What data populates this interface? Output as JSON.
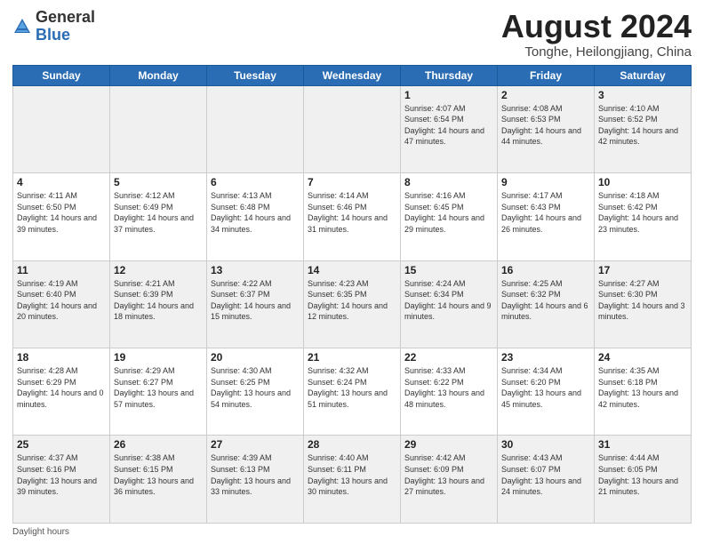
{
  "header": {
    "logo_general": "General",
    "logo_blue": "Blue",
    "month_title": "August 2024",
    "location": "Tonghe, Heilongjiang, China"
  },
  "days_of_week": [
    "Sunday",
    "Monday",
    "Tuesday",
    "Wednesday",
    "Thursday",
    "Friday",
    "Saturday"
  ],
  "weeks": [
    [
      {
        "day": "",
        "info": ""
      },
      {
        "day": "",
        "info": ""
      },
      {
        "day": "",
        "info": ""
      },
      {
        "day": "",
        "info": ""
      },
      {
        "day": "1",
        "info": "Sunrise: 4:07 AM\nSunset: 6:54 PM\nDaylight: 14 hours and 47 minutes."
      },
      {
        "day": "2",
        "info": "Sunrise: 4:08 AM\nSunset: 6:53 PM\nDaylight: 14 hours and 44 minutes."
      },
      {
        "day": "3",
        "info": "Sunrise: 4:10 AM\nSunset: 6:52 PM\nDaylight: 14 hours and 42 minutes."
      }
    ],
    [
      {
        "day": "4",
        "info": "Sunrise: 4:11 AM\nSunset: 6:50 PM\nDaylight: 14 hours and 39 minutes."
      },
      {
        "day": "5",
        "info": "Sunrise: 4:12 AM\nSunset: 6:49 PM\nDaylight: 14 hours and 37 minutes."
      },
      {
        "day": "6",
        "info": "Sunrise: 4:13 AM\nSunset: 6:48 PM\nDaylight: 14 hours and 34 minutes."
      },
      {
        "day": "7",
        "info": "Sunrise: 4:14 AM\nSunset: 6:46 PM\nDaylight: 14 hours and 31 minutes."
      },
      {
        "day": "8",
        "info": "Sunrise: 4:16 AM\nSunset: 6:45 PM\nDaylight: 14 hours and 29 minutes."
      },
      {
        "day": "9",
        "info": "Sunrise: 4:17 AM\nSunset: 6:43 PM\nDaylight: 14 hours and 26 minutes."
      },
      {
        "day": "10",
        "info": "Sunrise: 4:18 AM\nSunset: 6:42 PM\nDaylight: 14 hours and 23 minutes."
      }
    ],
    [
      {
        "day": "11",
        "info": "Sunrise: 4:19 AM\nSunset: 6:40 PM\nDaylight: 14 hours and 20 minutes."
      },
      {
        "day": "12",
        "info": "Sunrise: 4:21 AM\nSunset: 6:39 PM\nDaylight: 14 hours and 18 minutes."
      },
      {
        "day": "13",
        "info": "Sunrise: 4:22 AM\nSunset: 6:37 PM\nDaylight: 14 hours and 15 minutes."
      },
      {
        "day": "14",
        "info": "Sunrise: 4:23 AM\nSunset: 6:35 PM\nDaylight: 14 hours and 12 minutes."
      },
      {
        "day": "15",
        "info": "Sunrise: 4:24 AM\nSunset: 6:34 PM\nDaylight: 14 hours and 9 minutes."
      },
      {
        "day": "16",
        "info": "Sunrise: 4:25 AM\nSunset: 6:32 PM\nDaylight: 14 hours and 6 minutes."
      },
      {
        "day": "17",
        "info": "Sunrise: 4:27 AM\nSunset: 6:30 PM\nDaylight: 14 hours and 3 minutes."
      }
    ],
    [
      {
        "day": "18",
        "info": "Sunrise: 4:28 AM\nSunset: 6:29 PM\nDaylight: 14 hours and 0 minutes."
      },
      {
        "day": "19",
        "info": "Sunrise: 4:29 AM\nSunset: 6:27 PM\nDaylight: 13 hours and 57 minutes."
      },
      {
        "day": "20",
        "info": "Sunrise: 4:30 AM\nSunset: 6:25 PM\nDaylight: 13 hours and 54 minutes."
      },
      {
        "day": "21",
        "info": "Sunrise: 4:32 AM\nSunset: 6:24 PM\nDaylight: 13 hours and 51 minutes."
      },
      {
        "day": "22",
        "info": "Sunrise: 4:33 AM\nSunset: 6:22 PM\nDaylight: 13 hours and 48 minutes."
      },
      {
        "day": "23",
        "info": "Sunrise: 4:34 AM\nSunset: 6:20 PM\nDaylight: 13 hours and 45 minutes."
      },
      {
        "day": "24",
        "info": "Sunrise: 4:35 AM\nSunset: 6:18 PM\nDaylight: 13 hours and 42 minutes."
      }
    ],
    [
      {
        "day": "25",
        "info": "Sunrise: 4:37 AM\nSunset: 6:16 PM\nDaylight: 13 hours and 39 minutes."
      },
      {
        "day": "26",
        "info": "Sunrise: 4:38 AM\nSunset: 6:15 PM\nDaylight: 13 hours and 36 minutes."
      },
      {
        "day": "27",
        "info": "Sunrise: 4:39 AM\nSunset: 6:13 PM\nDaylight: 13 hours and 33 minutes."
      },
      {
        "day": "28",
        "info": "Sunrise: 4:40 AM\nSunset: 6:11 PM\nDaylight: 13 hours and 30 minutes."
      },
      {
        "day": "29",
        "info": "Sunrise: 4:42 AM\nSunset: 6:09 PM\nDaylight: 13 hours and 27 minutes."
      },
      {
        "day": "30",
        "info": "Sunrise: 4:43 AM\nSunset: 6:07 PM\nDaylight: 13 hours and 24 minutes."
      },
      {
        "day": "31",
        "info": "Sunrise: 4:44 AM\nSunset: 6:05 PM\nDaylight: 13 hours and 21 minutes."
      }
    ]
  ],
  "footer": {
    "daylight_label": "Daylight hours"
  }
}
